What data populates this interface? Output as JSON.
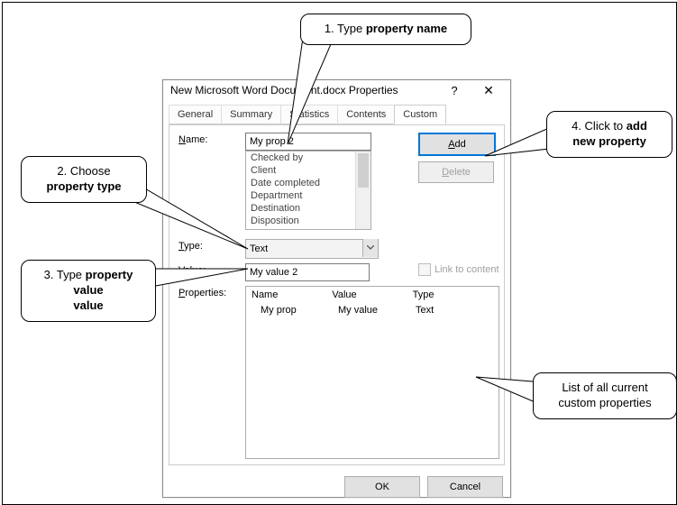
{
  "dialog": {
    "title": "New Microsoft Word Document.docx Properties",
    "help": "?",
    "close": "✕",
    "tabs": {
      "general": "General",
      "summary": "Summary",
      "statistics": "Statistics",
      "contents": "Contents",
      "custom": "Custom"
    },
    "labels": {
      "name": "Name:",
      "type": "Type:",
      "value": "Value:",
      "properties": "Properties:",
      "link": "Link to content"
    },
    "name_value": "My prop 2",
    "name_list": [
      "Checked by",
      "Client",
      "Date completed",
      "Department",
      "Destination",
      "Disposition"
    ],
    "type_value": "Text",
    "value_value": "My value 2",
    "buttons": {
      "add": "Add",
      "delete": "Delete",
      "ok": "OK",
      "cancel": "Cancel"
    },
    "table": {
      "headers": {
        "name": "Name",
        "value": "Value",
        "type": "Type"
      },
      "rows": [
        {
          "name": "My prop",
          "value": "My value",
          "type": "Text"
        }
      ]
    }
  },
  "callouts": {
    "c1a": "1. Type ",
    "c1b": "property name",
    "c2a": "2. Choose",
    "c2b": "property type",
    "c3a": "3. Type ",
    "c3b": "property value",
    "c4a": "4. Click to ",
    "c4b": "add new property",
    "c5a": "List of all current",
    "c5b": "custom properties"
  }
}
